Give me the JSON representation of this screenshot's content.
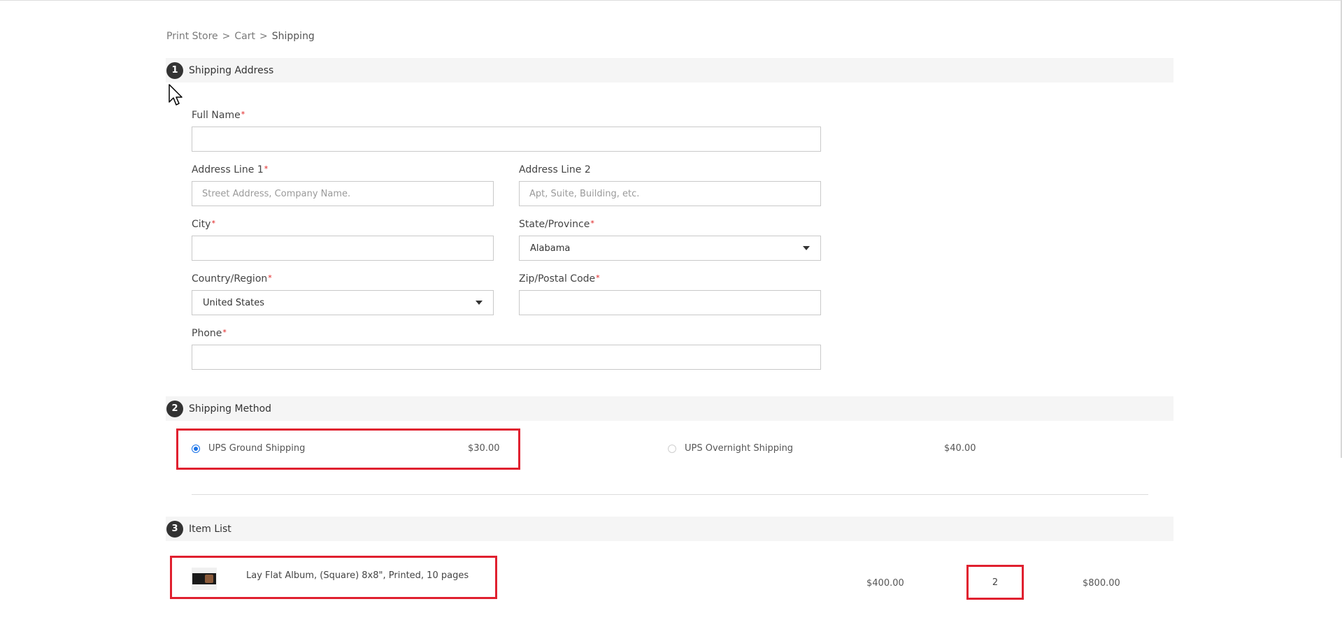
{
  "breadcrumb": {
    "items": [
      "Print Store",
      "Cart",
      "Shipping"
    ],
    "separator": ">"
  },
  "sections": {
    "address": {
      "step": "1",
      "title": "Shipping Address"
    },
    "method": {
      "step": "2",
      "title": "Shipping Method"
    },
    "items": {
      "step": "3",
      "title": "Item List"
    }
  },
  "address_form": {
    "full_name": {
      "label": "Full Name",
      "required": "*",
      "value": "",
      "placeholder": ""
    },
    "address1": {
      "label": "Address Line 1",
      "required": "*",
      "value": "",
      "placeholder": "Street Address, Company Name."
    },
    "address2": {
      "label": "Address Line 2",
      "value": "",
      "placeholder": "Apt, Suite, Building, etc."
    },
    "city": {
      "label": "City",
      "required": "*",
      "value": "",
      "placeholder": ""
    },
    "state": {
      "label": "State/Province",
      "required": "*",
      "selected": "Alabama"
    },
    "country": {
      "label": "Country/Region",
      "required": "*",
      "selected": "United States"
    },
    "zip": {
      "label": "Zip/Postal Code",
      "required": "*",
      "value": "",
      "placeholder": ""
    },
    "phone": {
      "label": "Phone",
      "required": "*",
      "value": "",
      "placeholder": ""
    }
  },
  "shipping_methods": [
    {
      "label": "UPS Ground Shipping",
      "price": "$30.00",
      "selected": true
    },
    {
      "label": "UPS Overnight Shipping",
      "price": "$40.00",
      "selected": false
    }
  ],
  "item_list": [
    {
      "name": "Lay Flat Album, (Square) 8x8\", Printed, 10 pages",
      "unit_price": "$400.00",
      "quantity": "2",
      "total": "$800.00"
    }
  ],
  "colors": {
    "accent_blue": "#1a73e8",
    "highlight_red": "#e0202f",
    "required_red": "#e02020",
    "section_bg": "#f5f5f5"
  },
  "icons": [
    "chevron-right-icon",
    "caret-down-icon",
    "radio-icon",
    "cursor-icon"
  ]
}
